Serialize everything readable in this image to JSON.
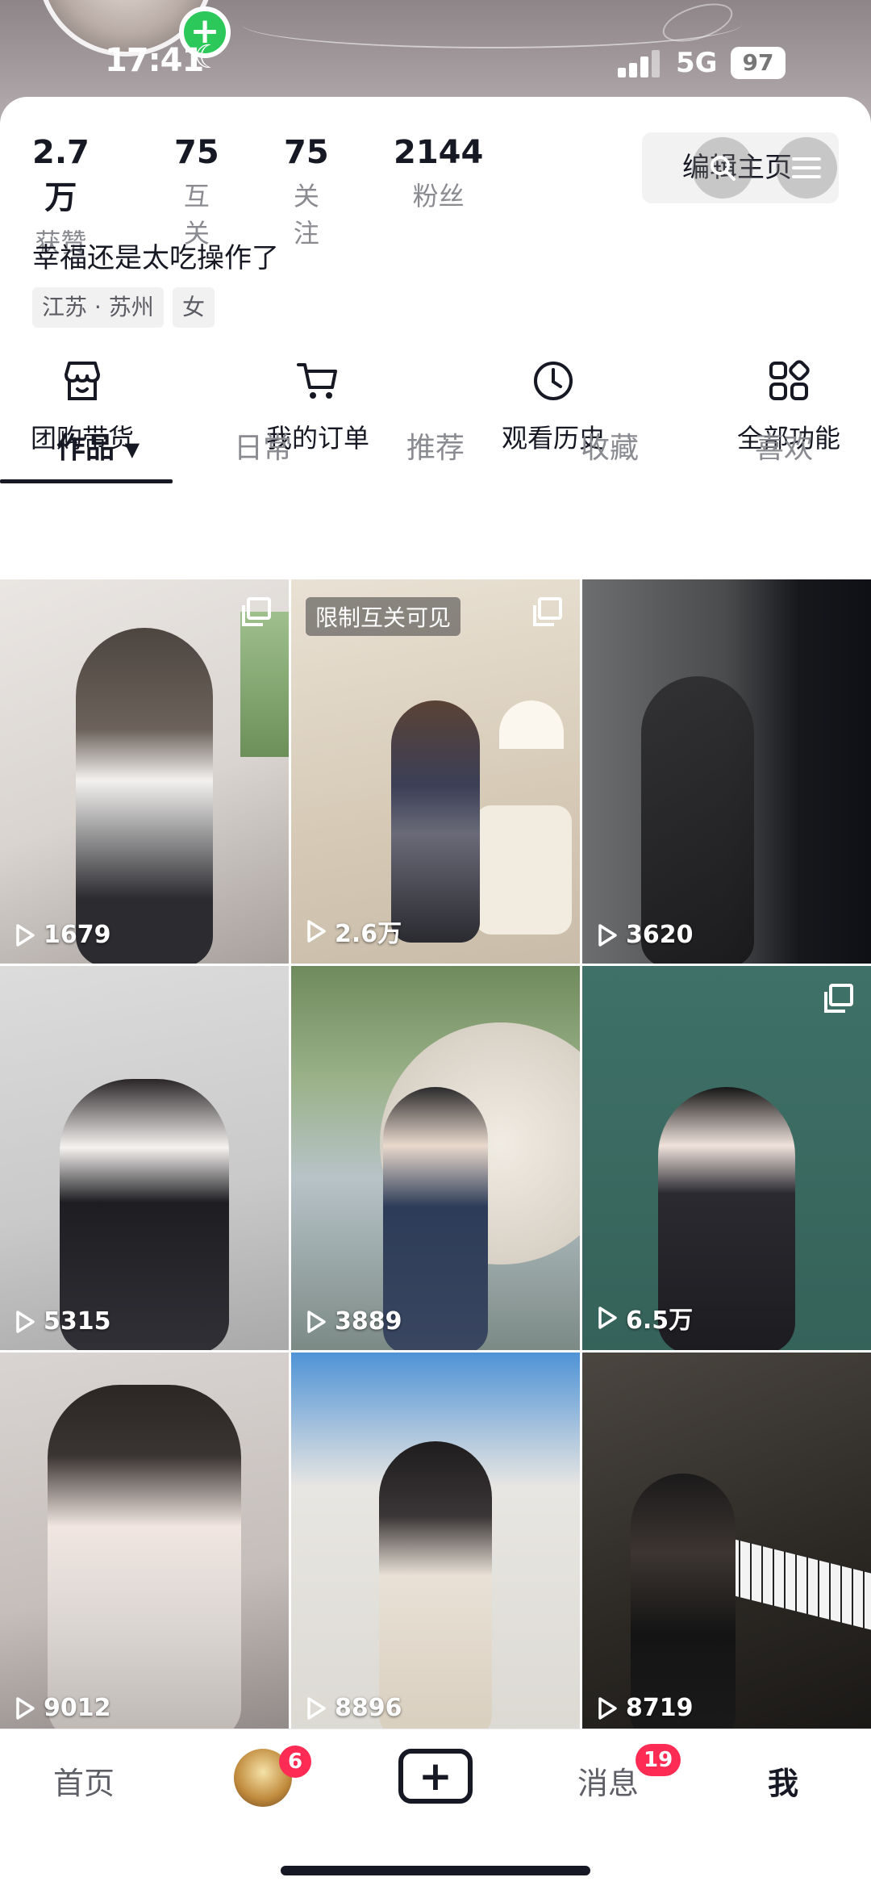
{
  "status_bar": {
    "time": "17:41",
    "network": "5G",
    "battery": "97"
  },
  "profile": {
    "stats": [
      {
        "value": "2.7万",
        "label": "获赞"
      },
      {
        "value": "75",
        "label": "互关"
      },
      {
        "value": "75",
        "label": "关注"
      },
      {
        "value": "2144",
        "label": "粉丝"
      }
    ],
    "edit_label": "编辑主页",
    "bio": "幸福还是太吃操作了",
    "tags": [
      "江苏 · 苏州",
      "女"
    ]
  },
  "features": [
    {
      "label": "团购带货",
      "icon": "store-icon"
    },
    {
      "label": "我的订单",
      "icon": "cart-icon"
    },
    {
      "label": "观看历史",
      "icon": "clock-icon"
    },
    {
      "label": "全部功能",
      "icon": "grid-icon"
    }
  ],
  "tabs": [
    "作品",
    "日常",
    "推荐",
    "收藏",
    "喜欢"
  ],
  "videos": [
    {
      "views": "1679",
      "label": "",
      "pinned": true
    },
    {
      "views": "2.6万",
      "label": "限制互关可见",
      "pinned": true
    },
    {
      "views": "3620",
      "label": "",
      "pinned": false
    },
    {
      "views": "5315",
      "label": "",
      "pinned": false
    },
    {
      "views": "3889",
      "label": "",
      "pinned": false
    },
    {
      "views": "6.5万",
      "label": "",
      "pinned": true
    },
    {
      "views": "9012",
      "label": "",
      "pinned": false
    },
    {
      "views": "8896",
      "label": "",
      "pinned": false
    },
    {
      "views": "8719",
      "label": "",
      "pinned": false
    }
  ],
  "bottom_nav": {
    "home": "首页",
    "friends_badge": "6",
    "messages": "消息",
    "messages_badge": "19",
    "me": "我"
  },
  "colors": {
    "accent": "#fe2c55",
    "text": "#161823",
    "muted": "#8a8b91"
  }
}
